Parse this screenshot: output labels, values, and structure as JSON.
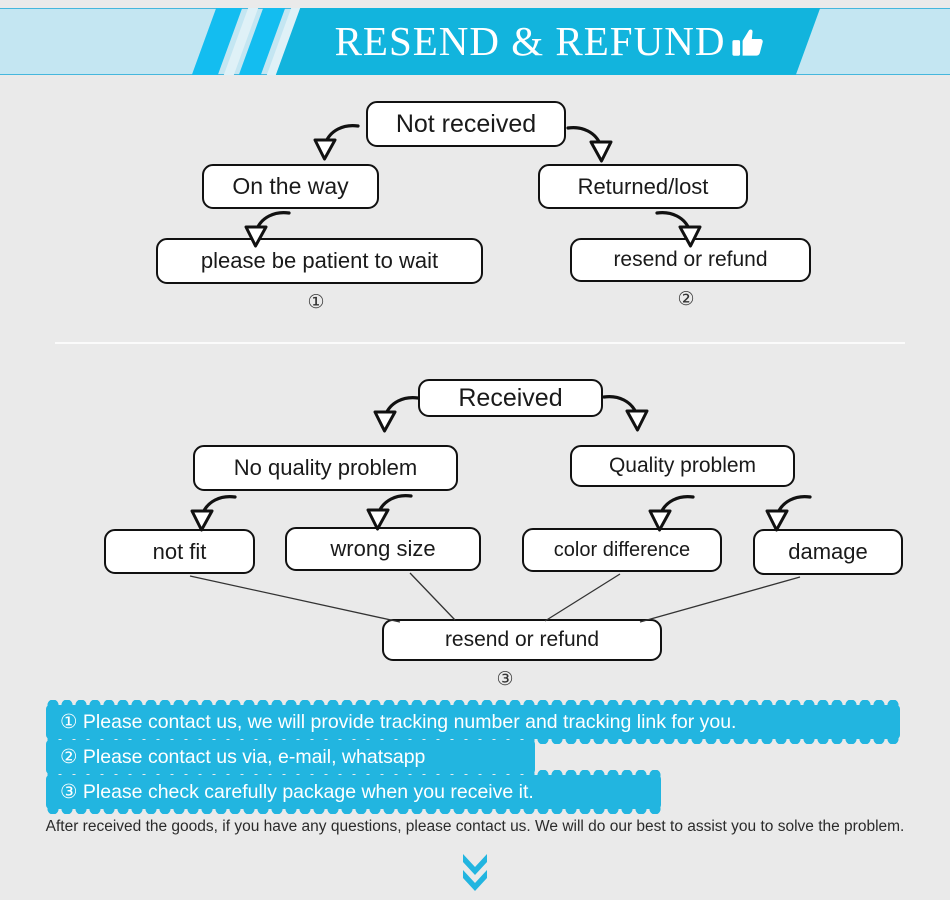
{
  "header": {
    "title": "RESEND & REFUND",
    "thumbs_up_icon": "thumbs-up-icon",
    "band_color": "#c4e6f2",
    "accent_color": "#12b4dd",
    "stripe_color": "#13bdf0"
  },
  "flow_not_received": {
    "root": "Not received",
    "left_branch": {
      "step1": "On the way",
      "step2": "please be patient to wait",
      "marker": "①"
    },
    "right_branch": {
      "step1": "Returned/lost",
      "step2": "resend or refund",
      "marker": "②"
    }
  },
  "flow_received": {
    "root": "Received",
    "left_branch": {
      "step1": "No quality problem",
      "leaf1": "not fit",
      "leaf2": "wrong size"
    },
    "right_branch": {
      "step1": "Quality problem",
      "leaf1": "color difference",
      "leaf2": "damage"
    },
    "outcome": "resend or refund",
    "marker": "③"
  },
  "notes": {
    "highlight_color": "#22b5e0",
    "items": [
      "① Please contact us, we will provide tracking number and tracking link for you.",
      "② Please contact us via, e-mail, whatsapp",
      "③ Please check carefully package when you receive it."
    ]
  },
  "footer": {
    "text": "After received the goods, if you have any questions, please contact us. We will do our best to assist you to solve the problem.",
    "chevron_icon": "chevron-double-down-icon",
    "chevron_color": "#22b5e0"
  }
}
